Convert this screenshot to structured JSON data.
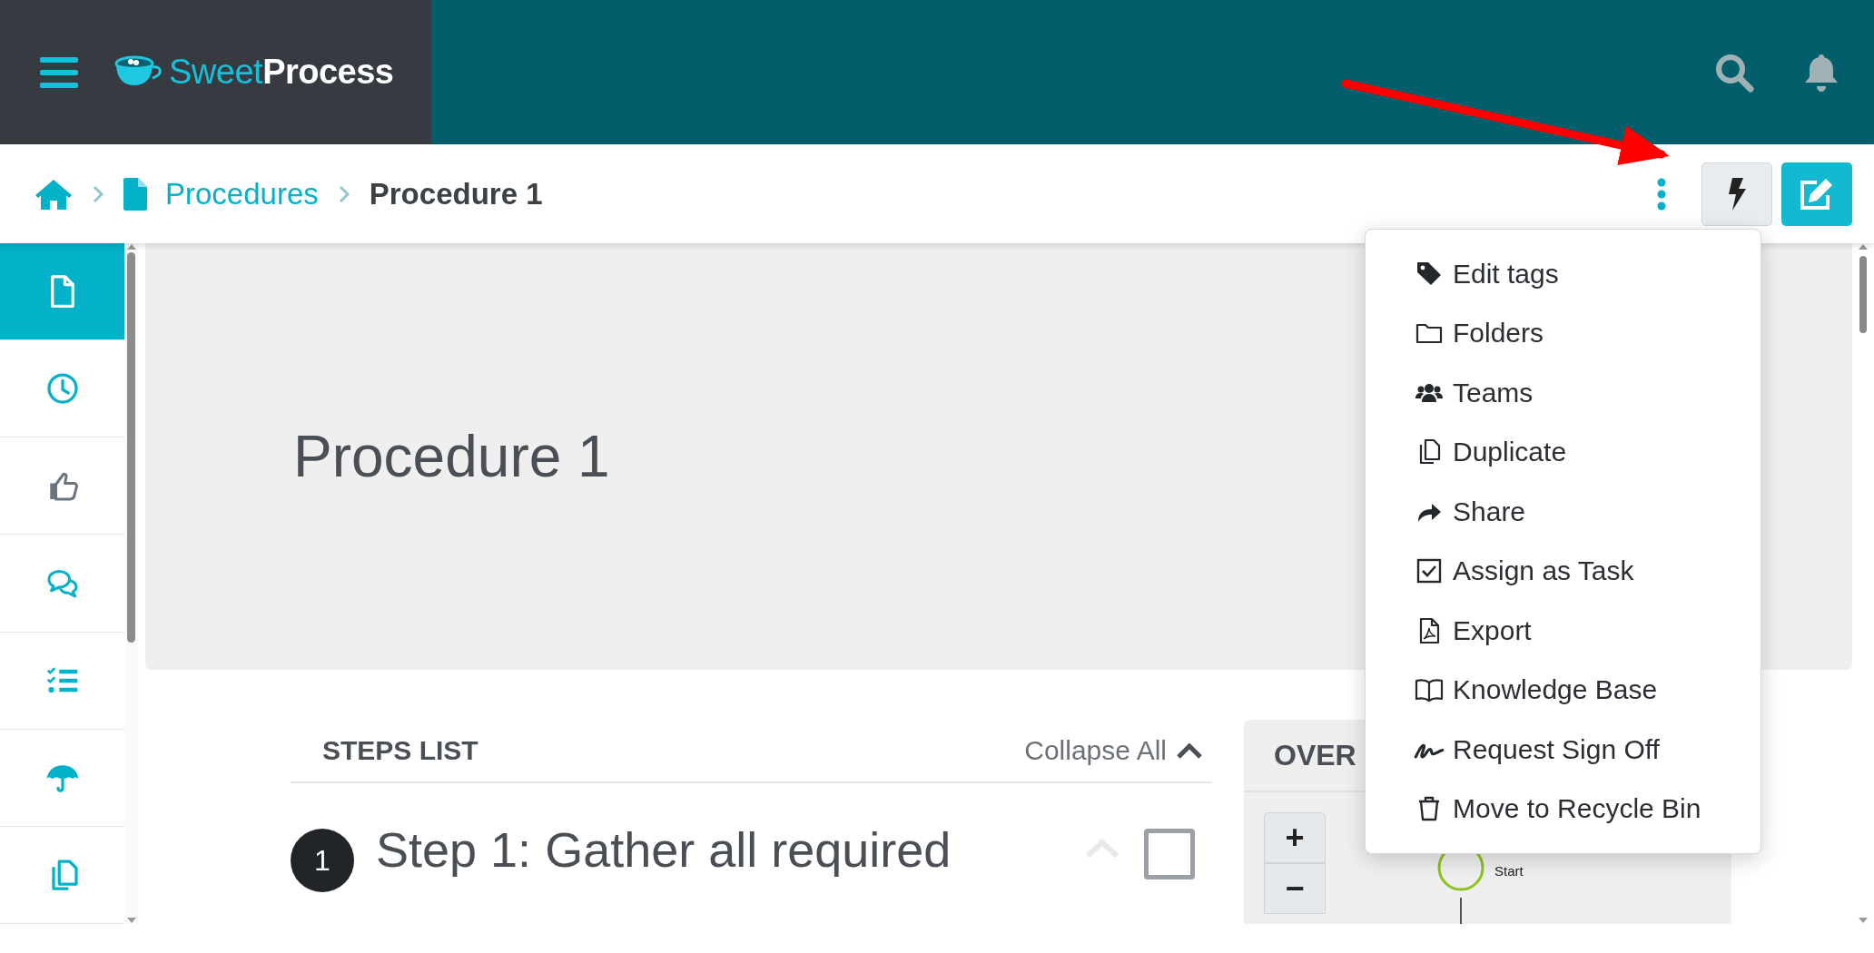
{
  "header": {
    "logo": {
      "light": "Sweet",
      "bold": "Process"
    }
  },
  "breadcrumb": [
    {
      "label": "Procedures",
      "kind": "link"
    },
    {
      "label": "Procedure 1",
      "kind": "current"
    }
  ],
  "sidebar": {
    "items": [
      {
        "selected": true
      },
      {
        "selected": false
      },
      {
        "selected": false
      },
      {
        "selected": false
      },
      {
        "selected": false
      },
      {
        "selected": false
      },
      {
        "selected": false
      }
    ]
  },
  "procedure": {
    "title": "Procedure 1"
  },
  "steps_list": {
    "title": "STEPS LIST",
    "collapse_label": "Collapse All"
  },
  "steps": [
    {
      "number": "1",
      "title": "Step 1: Gather all required",
      "checked": false
    }
  ],
  "overview": {
    "title": "OVER",
    "zoom_in": "+",
    "zoom_out": "−",
    "start_label": "Start"
  },
  "actions_menu": {
    "items": [
      {
        "label": "Edit tags"
      },
      {
        "label": "Folders"
      },
      {
        "label": "Teams"
      },
      {
        "label": "Duplicate"
      },
      {
        "label": "Share"
      },
      {
        "label": "Assign as Task"
      },
      {
        "label": "Export"
      },
      {
        "label": "Knowledge Base"
      },
      {
        "label": "Request Sign Off"
      },
      {
        "label": "Move to Recycle Bin"
      }
    ]
  }
}
